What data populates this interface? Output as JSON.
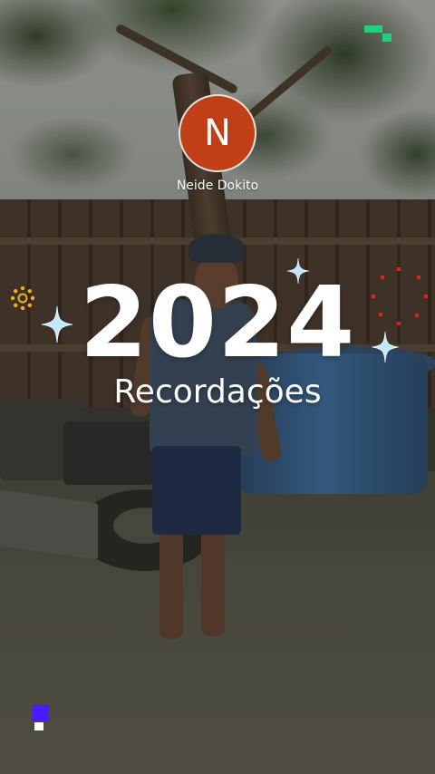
{
  "profile": {
    "avatar_initial": "N",
    "name": "Neide Dokito",
    "avatar_color": "#c13f17"
  },
  "headline": {
    "year": "2024",
    "subtitle": "Recordações"
  },
  "decorations": {
    "accent_colors": {
      "sparkle": "#bfe7ff",
      "pixel_green": "#1fd17a",
      "pixel_blue": "#4a1bff",
      "red_dots": "#e0231a",
      "ring": "#f2b01c"
    },
    "icons": [
      "sparkle-icon",
      "pixel-corner-icon",
      "dotted-ring-icon",
      "red-dot-constellation-icon"
    ]
  }
}
